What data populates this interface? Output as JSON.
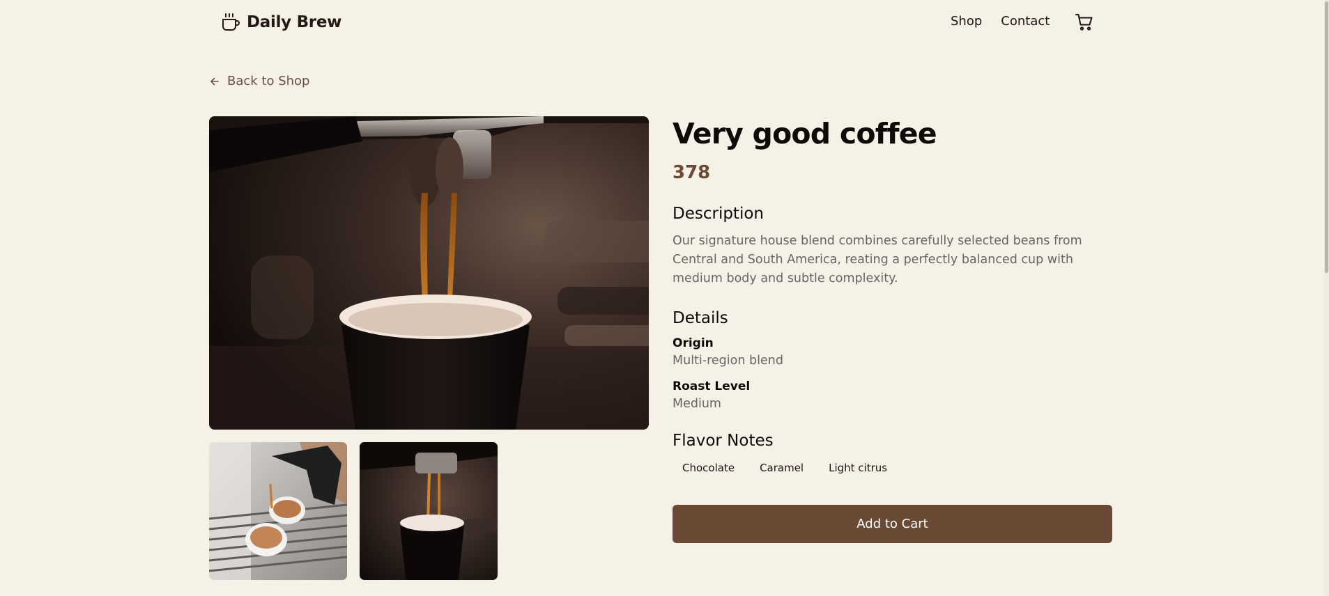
{
  "header": {
    "brand_name": "Daily Brew",
    "brand_icon": "coffee-cup-icon",
    "nav": [
      "Shop",
      "Contact"
    ],
    "cart_icon": "cart-icon"
  },
  "back_link": {
    "label": "Back to Shop",
    "icon": "arrow-left-icon"
  },
  "gallery": {
    "main_image": "espresso pouring into a paper cup",
    "thumbnails": [
      "two espresso cups on a machine grate",
      "espresso pouring into a paper cup"
    ]
  },
  "product": {
    "title": "Very good coffee",
    "price": "378",
    "description_heading": "Description",
    "description": "Our signature house blend combines carefully selected beans from Central and South America, reating a perfectly balanced cup with medium body and subtle complexity.",
    "details_heading": "Details",
    "details": [
      {
        "label": "Origin",
        "value": "Multi-region blend"
      },
      {
        "label": "Roast Level",
        "value": "Medium"
      }
    ],
    "flavor_heading": "Flavor Notes",
    "flavor_notes": [
      "Chocolate",
      "Caramel",
      "Light citrus"
    ],
    "add_to_cart_label": "Add to Cart"
  },
  "colors": {
    "background": "#f6f1e7",
    "accent": "#6b4a35",
    "muted_text": "#6a6460"
  }
}
